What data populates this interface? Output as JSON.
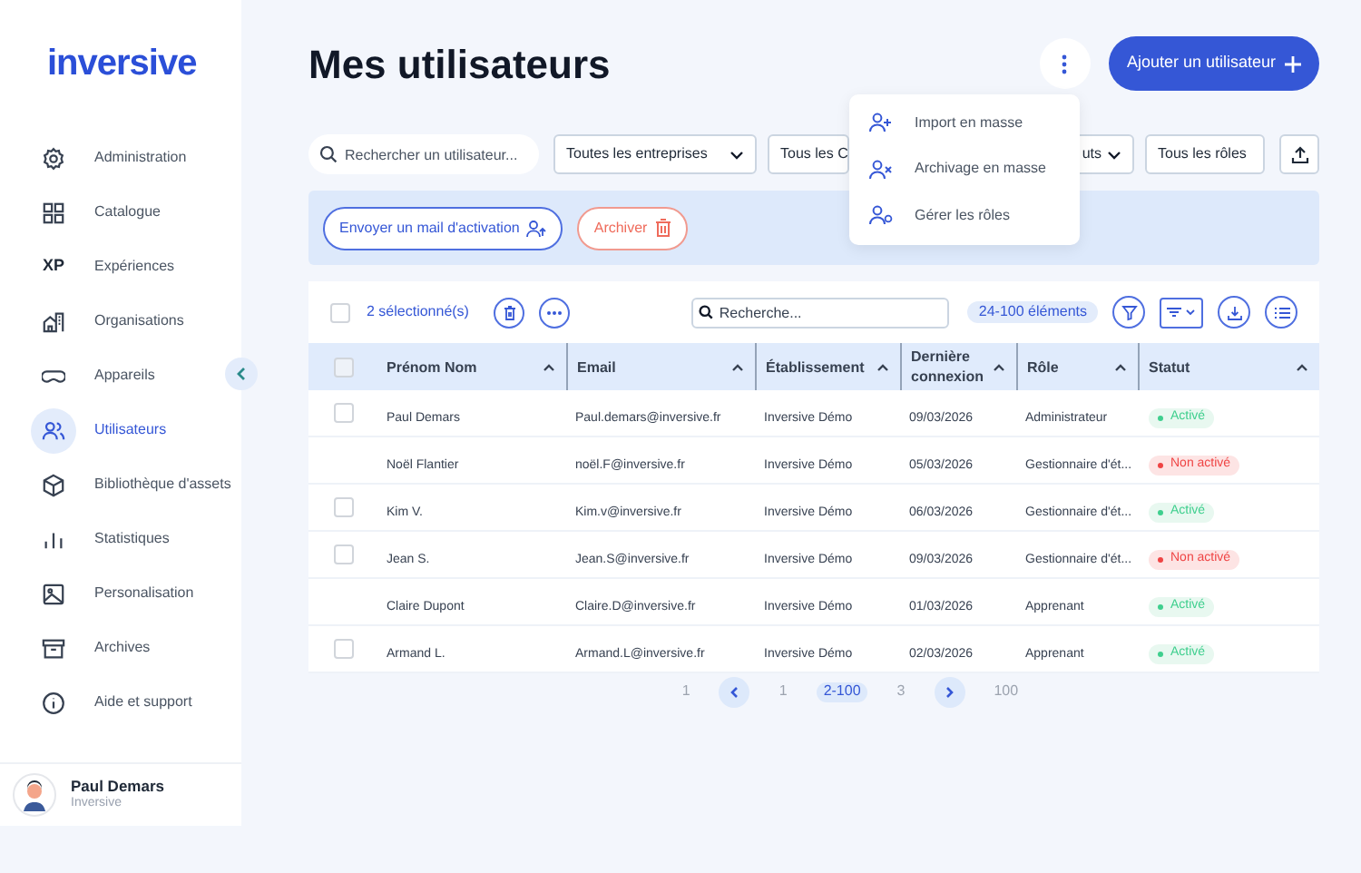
{
  "logo": "inversive",
  "sidebar": {
    "items": [
      {
        "label": "Administration",
        "selected": false
      },
      {
        "label": "Catalogue",
        "selected": false
      },
      {
        "label": "Expériences",
        "selected": false,
        "icon_text": "XP"
      },
      {
        "label": "Organisations",
        "selected": false
      },
      {
        "label": "Appareils",
        "selected": false
      },
      {
        "label": "Utilisateurs",
        "selected": true
      },
      {
        "label": "Bibliothèque d'assets",
        "selected": false
      },
      {
        "label": "Statistiques",
        "selected": false
      },
      {
        "label": "Personalisation",
        "selected": false
      },
      {
        "label": "Archives",
        "selected": false
      },
      {
        "label": "Aide et support",
        "selected": false
      }
    ],
    "user": {
      "name": "Paul Demars",
      "org": "Inversive"
    }
  },
  "title": "Mes utilisateurs",
  "add_button": "Ajouter un utilisateur",
  "menu": [
    "Import en masse",
    "Archivage en masse",
    "Gérer les rôles"
  ],
  "filters": {
    "search_placeholder": "Rechercher un utilisateur...",
    "selects": [
      "Toutes les entreprises",
      "Tous les C",
      "uts",
      "Tous les rôles"
    ]
  },
  "actions": {
    "mail_button": "Envoyer un mail d'activation",
    "archive_button": "Archiver"
  },
  "table": {
    "toolbar_checked": false,
    "header_checked": false,
    "selected_count": "2 sélectionné(s)",
    "search_placeholder": "Recherche...",
    "count_badge": "24-100 éléments",
    "columns": [
      "Prénom Nom",
      "Email",
      "Établissement",
      "Dernière connexion",
      "Rôle",
      "Statut"
    ],
    "rows": [
      {
        "has_checkbox": true,
        "checked": false,
        "cells": [
          "Paul Demars",
          "Paul.demars@inversive.fr",
          "Inversive Démo",
          "09/03/2026",
          "Administrateur"
        ],
        "status": "Activé",
        "active": true
      },
      {
        "has_checkbox": false,
        "cells": [
          "Noël Flantier",
          "noël.F@inversive.fr",
          "Inversive Démo",
          "05/03/2026",
          "Gestionnaire d'ét..."
        ],
        "status": "Non activé",
        "active": false
      },
      {
        "has_checkbox": true,
        "checked": false,
        "cells": [
          "Kim V.",
          "Kim.v@inversive.fr",
          "Inversive Démo",
          "06/03/2026",
          "Gestionnaire d'ét..."
        ],
        "status": "Activé",
        "active": true
      },
      {
        "has_checkbox": true,
        "checked": false,
        "cells": [
          "Jean S.",
          "Jean.S@inversive.fr",
          "Inversive Démo",
          "09/03/2026",
          "Gestionnaire d'ét..."
        ],
        "status": "Non activé",
        "active": false
      },
      {
        "has_checkbox": false,
        "cells": [
          "Claire Dupont",
          "Claire.D@inversive.fr",
          "Inversive Démo",
          "01/03/2026",
          "Apprenant"
        ],
        "status": "Activé",
        "active": true
      },
      {
        "has_checkbox": true,
        "checked": false,
        "cells": [
          "Armand L.",
          "Armand.L@inversive.fr",
          "Inversive Démo",
          "02/03/2026",
          "Apprenant"
        ],
        "status": "Activé",
        "active": true
      }
    ]
  },
  "pagination": [
    {
      "label": "1",
      "kind": "page",
      "selected": false
    },
    {
      "kind": "prev"
    },
    {
      "label": "1",
      "kind": "page",
      "selected": false
    },
    {
      "label": "2-100",
      "kind": "page",
      "selected": true
    },
    {
      "label": "3",
      "kind": "page",
      "selected": false
    },
    {
      "kind": "next"
    },
    {
      "label": "100",
      "kind": "page",
      "selected": false
    }
  ]
}
